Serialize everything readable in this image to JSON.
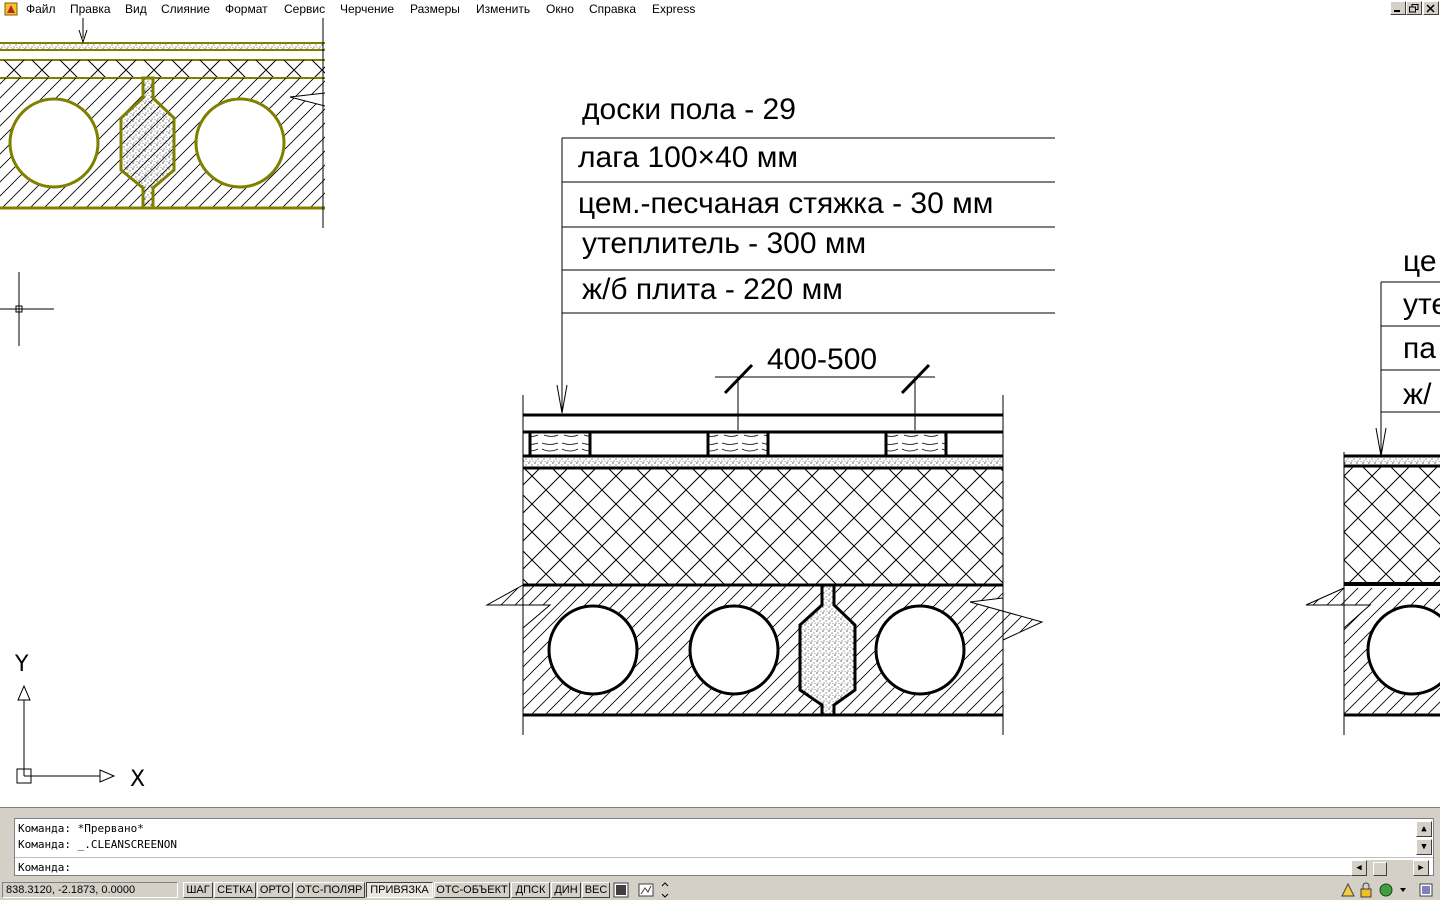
{
  "menu": {
    "items": [
      "Файл",
      "Правка",
      "Вид",
      "Слияние",
      "Формат",
      "Сервис",
      "Черчение",
      "Размеры",
      "Изменить",
      "Окно",
      "Справка",
      "Express"
    ]
  },
  "window_controls": {
    "minimize_icon": "minimize-icon",
    "restore_icon": "restore-icon",
    "close_icon": "close-icon"
  },
  "drawing": {
    "layers_main": [
      "доски пола - 29",
      "лага 100×40 мм",
      "цем.-песчаная стяжка - 30 мм",
      "утеплитель - 300 мм",
      "ж/б плита - 220 мм"
    ],
    "dimension": "400-500",
    "layers_right": [
      "це",
      "уте",
      "па",
      "ж/"
    ],
    "ucs": {
      "y": "Y",
      "x": "X"
    }
  },
  "command": {
    "history": [
      "Команда: *Прервано*",
      "Команда: _.CLEANSCREENON"
    ],
    "prompt": "Команда:"
  },
  "status": {
    "coordinates": "838.3120, -2.1873, 0.0000",
    "buttons": [
      "ШАГ",
      "СЕТКА",
      "ОРТО",
      "ОТС-ПОЛЯР",
      "ПРИВЯЗКА",
      "ОТС-ОБЪЕКТ",
      "ДПСК",
      "ДИН",
      "ВЕС"
    ],
    "active": [
      "ПРИВЯЗКА"
    ]
  },
  "colors": {
    "background_canvas": "#ffffff",
    "olive_linework": "#808000",
    "chrome": "#d4d0c8"
  }
}
